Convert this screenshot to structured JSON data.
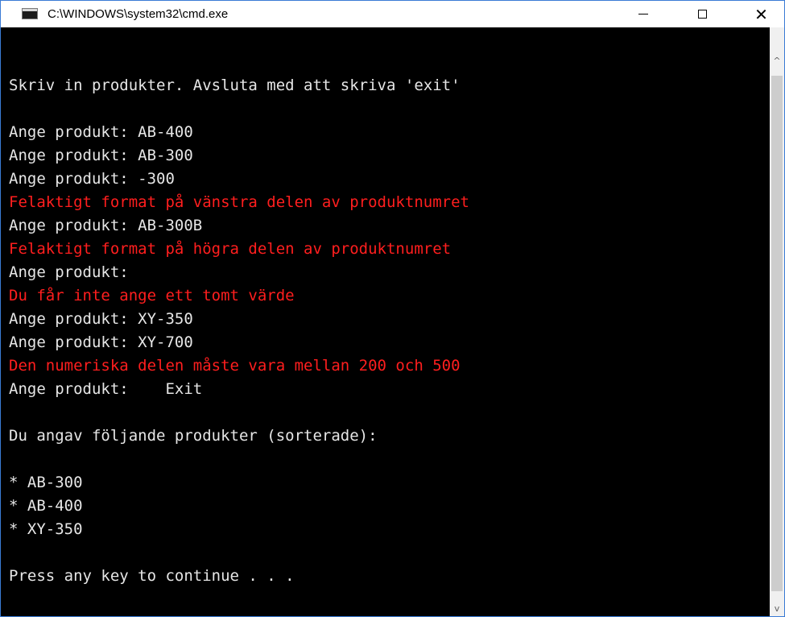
{
  "window": {
    "title": "C:\\WINDOWS\\system32\\cmd.exe",
    "icon_text": "C:\\",
    "controls": {
      "minimize": "minimize-icon",
      "maximize": "maximize-icon",
      "close": "close-icon",
      "close_glyph": "✕"
    }
  },
  "console": {
    "default_color": "#e6e6e6",
    "error_color": "#ff1e1e",
    "lines": [
      {
        "text": "Skriv in produkter. Avsluta med att skriva 'exit'",
        "type": "normal"
      },
      {
        "text": "",
        "type": "normal"
      },
      {
        "text": "Ange produkt: AB-400",
        "type": "normal"
      },
      {
        "text": "Ange produkt: AB-300",
        "type": "normal"
      },
      {
        "text": "Ange produkt: -300",
        "type": "normal"
      },
      {
        "text": "Felaktigt format på vänstra delen av produktnumret",
        "type": "error"
      },
      {
        "text": "Ange produkt: AB-300B",
        "type": "normal"
      },
      {
        "text": "Felaktigt format på högra delen av produktnumret",
        "type": "error"
      },
      {
        "text": "Ange produkt:",
        "type": "normal"
      },
      {
        "text": "Du får inte ange ett tomt värde",
        "type": "error"
      },
      {
        "text": "Ange produkt: XY-350",
        "type": "normal"
      },
      {
        "text": "Ange produkt: XY-700",
        "type": "normal"
      },
      {
        "text": "Den numeriska delen måste vara mellan 200 och 500",
        "type": "error"
      },
      {
        "text": "Ange produkt:    Exit",
        "type": "normal"
      },
      {
        "text": "",
        "type": "normal"
      },
      {
        "text": "Du angav följande produkter (sorterade):",
        "type": "normal"
      },
      {
        "text": "",
        "type": "normal"
      },
      {
        "text": "* AB-300",
        "type": "normal"
      },
      {
        "text": "* AB-400",
        "type": "normal"
      },
      {
        "text": "* XY-350",
        "type": "normal"
      },
      {
        "text": "",
        "type": "normal"
      },
      {
        "text": "Press any key to continue . . .",
        "type": "normal"
      }
    ]
  },
  "scrollbar": {
    "up_arrow": "^",
    "down_arrow": "v"
  }
}
